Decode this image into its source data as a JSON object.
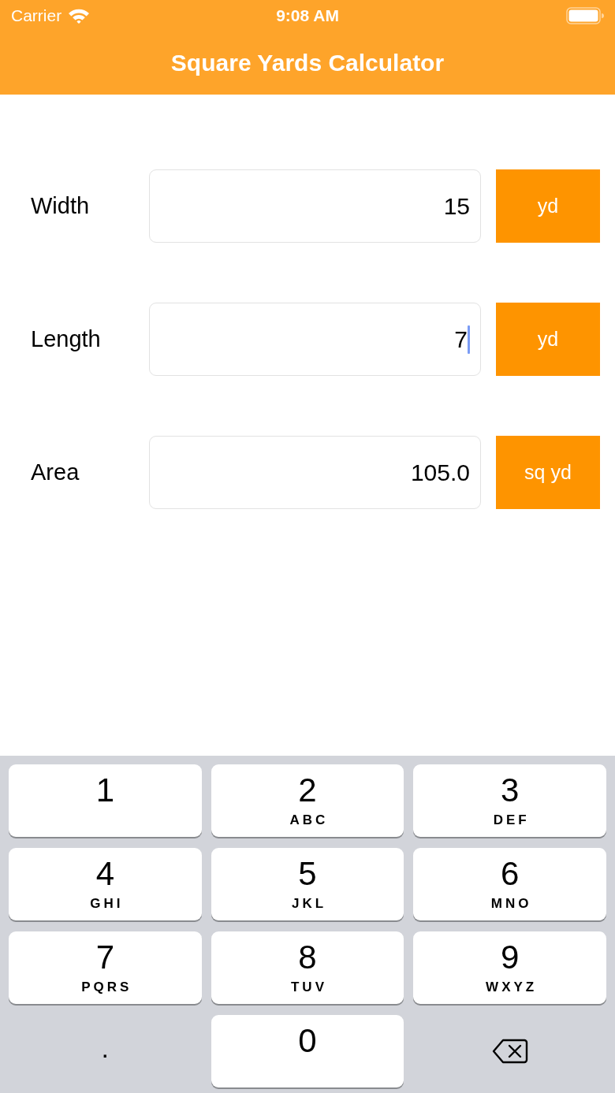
{
  "status_bar": {
    "carrier": "Carrier",
    "time": "9:08 AM"
  },
  "nav_bar": {
    "title": "Square Yards Calculator"
  },
  "fields": [
    {
      "label": "Width",
      "value": "15",
      "unit": "yd",
      "focused": false
    },
    {
      "label": "Length",
      "value": "7",
      "unit": "yd",
      "focused": true
    },
    {
      "label": "Area",
      "value": "105.0",
      "unit": "sq yd",
      "focused": false
    }
  ],
  "keypad": {
    "rows": [
      {
        "keys": [
          {
            "kind": "digit",
            "digit": "1"
          },
          {
            "kind": "digit",
            "digit": "2",
            "letters": "ABC"
          },
          {
            "kind": "digit",
            "digit": "3",
            "letters": "DEF"
          }
        ]
      },
      {
        "keys": [
          {
            "kind": "digit",
            "digit": "4",
            "letters": "GHI"
          },
          {
            "kind": "digit",
            "digit": "5",
            "letters": "JKL"
          },
          {
            "kind": "digit",
            "digit": "6",
            "letters": "MNO"
          }
        ]
      },
      {
        "keys": [
          {
            "kind": "digit",
            "digit": "7",
            "letters": "PQRS"
          },
          {
            "kind": "digit",
            "digit": "8",
            "letters": "TUV"
          },
          {
            "kind": "digit",
            "digit": "9",
            "letters": "WXYZ"
          }
        ]
      },
      {
        "keys": [
          {
            "kind": "decimal",
            "symbol": "."
          },
          {
            "kind": "digit",
            "digit": "0"
          },
          {
            "kind": "delete"
          }
        ]
      }
    ]
  }
}
